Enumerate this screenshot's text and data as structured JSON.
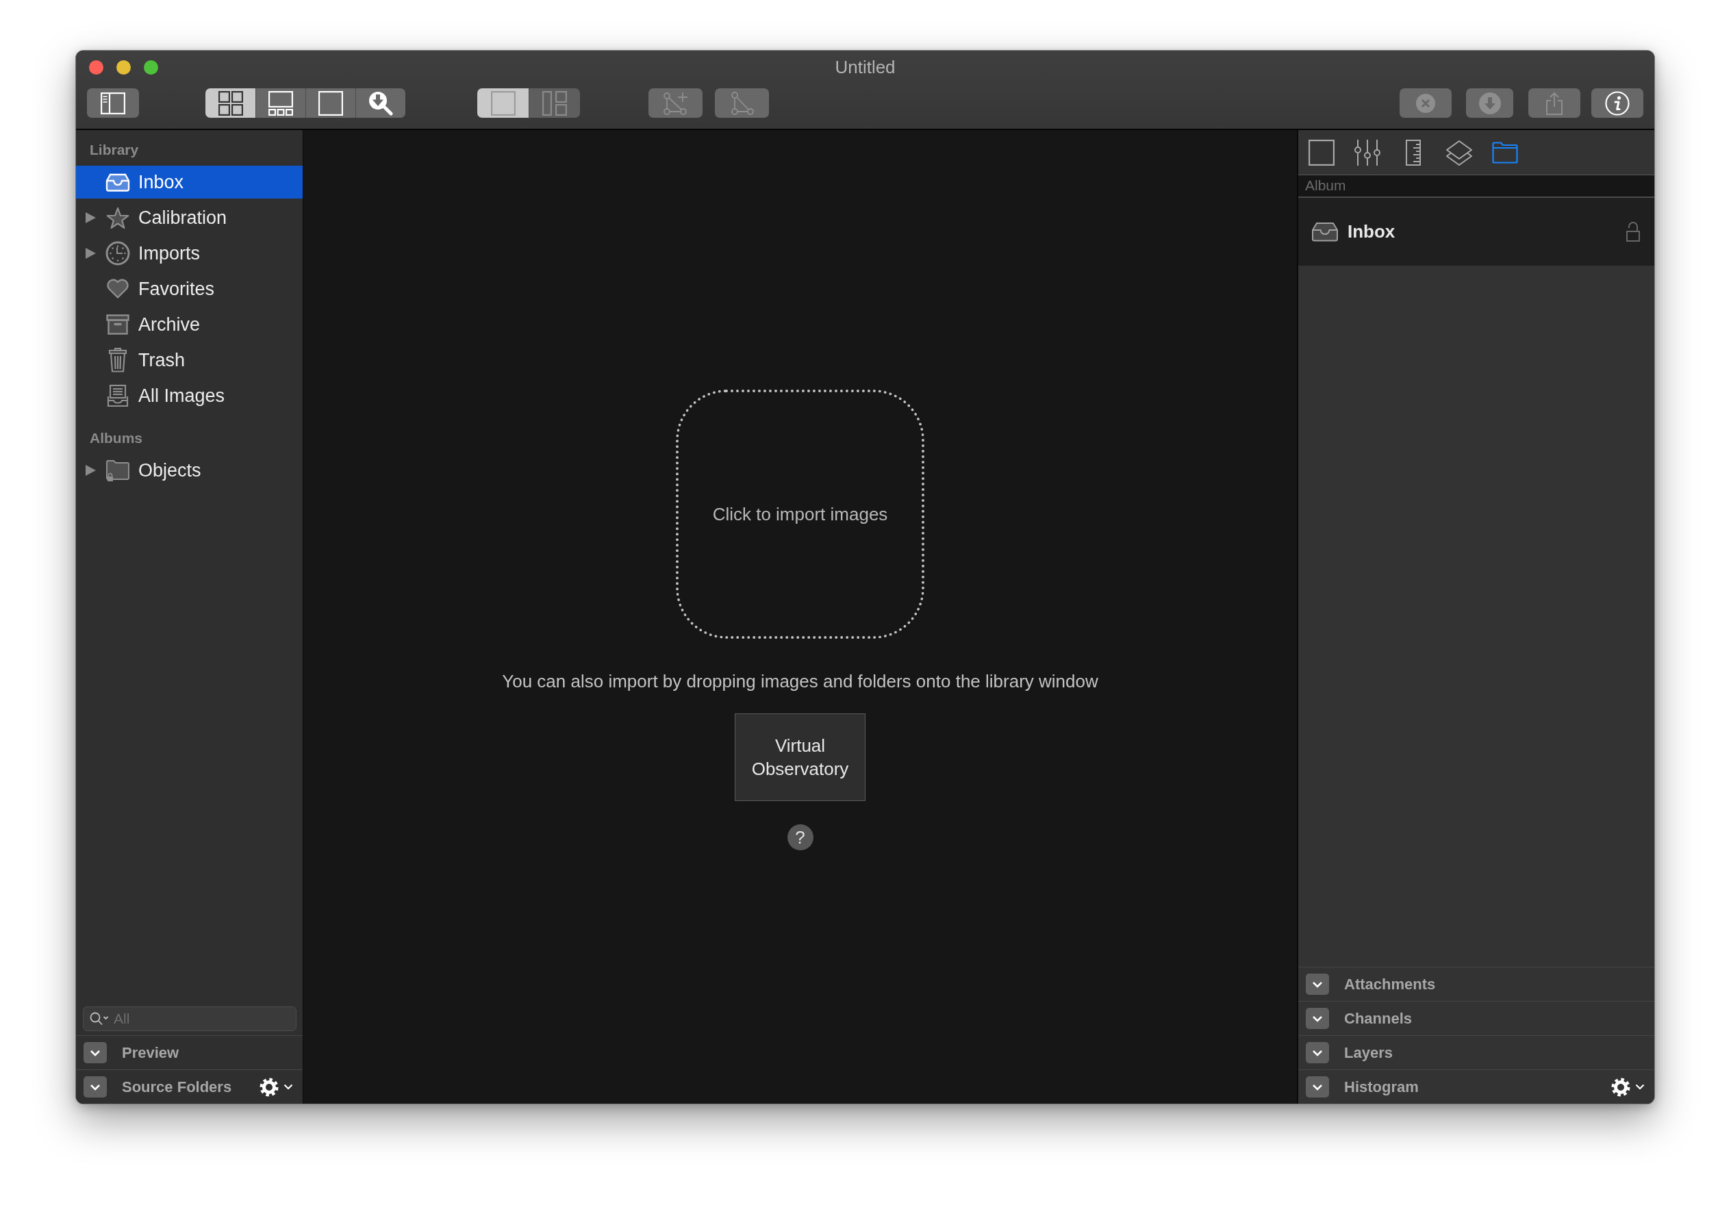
{
  "window": {
    "title": "Untitled"
  },
  "toolbar": {
    "sidebar_toggle": {
      "disabled": false
    },
    "view_modes": {
      "disabled": false,
      "segments": [
        {
          "kind": "grid",
          "selected": true
        },
        {
          "kind": "filmstrip",
          "selected": false
        },
        {
          "kind": "single",
          "selected": false
        },
        {
          "kind": "zoom",
          "selected": false
        }
      ]
    },
    "layout_modes": {
      "disabled": true,
      "segments": [
        {
          "kind": "single",
          "selected": true
        },
        {
          "kind": "split",
          "selected": false
        }
      ]
    },
    "shape_tools": [
      {
        "kind": "add_vertex",
        "disabled": true
      },
      {
        "kind": "polygon",
        "disabled": true
      }
    ],
    "actions": [
      {
        "kind": "remove",
        "disabled": true
      },
      {
        "kind": "download",
        "disabled": true
      },
      {
        "kind": "share",
        "disabled": true
      },
      {
        "kind": "info",
        "disabled": false
      }
    ]
  },
  "sidebar": {
    "sections": [
      {
        "title": "Library",
        "items": [
          {
            "label": "Inbox",
            "kind": "inbox",
            "selected": true,
            "expandable": false
          },
          {
            "label": "Calibration",
            "kind": "star",
            "selected": false,
            "expandable": true,
            "expanded": false
          },
          {
            "label": "Imports",
            "kind": "clock",
            "selected": false,
            "expandable": true,
            "expanded": false
          },
          {
            "label": "Favorites",
            "kind": "heart",
            "selected": false,
            "expandable": false
          },
          {
            "label": "Archive",
            "kind": "archive",
            "selected": false,
            "expandable": false
          },
          {
            "label": "Trash",
            "kind": "trash",
            "selected": false,
            "expandable": false
          },
          {
            "label": "All Images",
            "kind": "stack",
            "selected": false,
            "expandable": false
          }
        ]
      },
      {
        "title": "Albums",
        "items": [
          {
            "label": "Objects",
            "kind": "locked_folder",
            "selected": false,
            "expandable": true,
            "expanded": false
          }
        ]
      }
    ],
    "search": {
      "placeholder": "All"
    },
    "panels": [
      {
        "label": "Preview",
        "expanded": false,
        "menu": false
      },
      {
        "label": "Source Folders",
        "expanded": false,
        "menu": true
      }
    ]
  },
  "main": {
    "drop_zone": {
      "label": "Click to import images"
    },
    "hint": "You can also import by dropping images and folders onto the library window",
    "button": {
      "label": "Virtual Observatory"
    },
    "help_button": {
      "label": "?"
    }
  },
  "inspector": {
    "tabs": [
      {
        "kind": "frame",
        "selected": false
      },
      {
        "kind": "sliders",
        "selected": false
      },
      {
        "kind": "ruler",
        "selected": false
      },
      {
        "kind": "layers",
        "selected": false
      },
      {
        "kind": "folder",
        "selected": true
      }
    ],
    "album": {
      "header": "Album",
      "name": "Inbox",
      "locked": false
    },
    "panels": [
      {
        "label": "Attachments",
        "expanded": false,
        "menu": false
      },
      {
        "label": "Channels",
        "expanded": false,
        "menu": false
      },
      {
        "label": "Layers",
        "expanded": false,
        "menu": false
      },
      {
        "label": "Histogram",
        "expanded": false,
        "menu": true
      }
    ]
  }
}
